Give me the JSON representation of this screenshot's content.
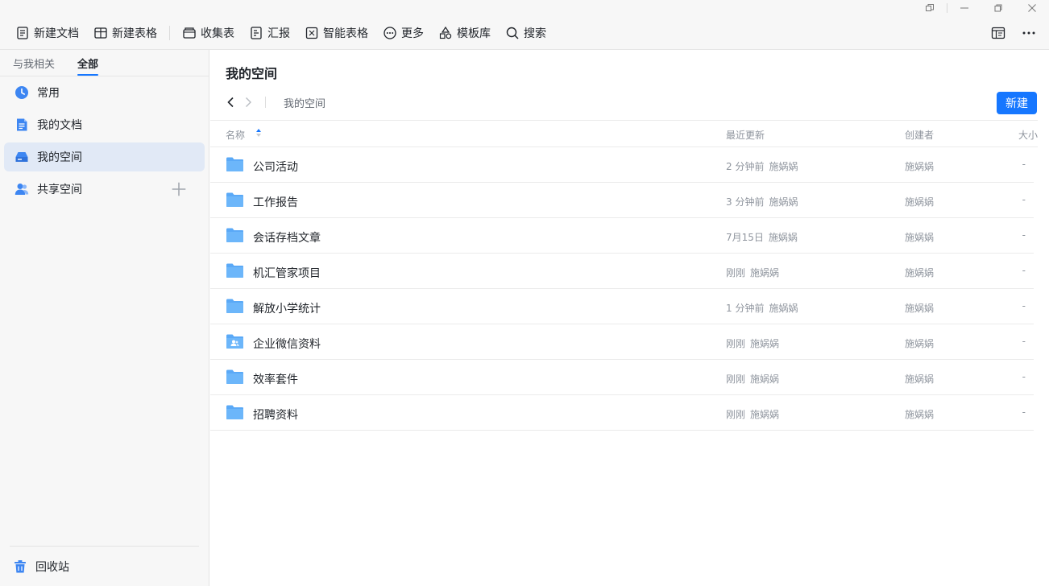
{
  "toolbar": {
    "items": [
      {
        "label": "新建文档",
        "icon": "doc-icon"
      },
      {
        "label": "新建表格",
        "icon": "table-icon"
      },
      {
        "label": "收集表",
        "icon": "form-icon"
      },
      {
        "label": "汇报",
        "icon": "report-icon"
      },
      {
        "label": "智能表格",
        "icon": "smart-table-icon"
      },
      {
        "label": "更多",
        "icon": "more-circle-icon"
      },
      {
        "label": "模板库",
        "icon": "template-icon"
      },
      {
        "label": "搜索",
        "icon": "search-icon"
      }
    ]
  },
  "sidebar": {
    "tabs": [
      "与我相关",
      "全部"
    ],
    "active_tab": 1,
    "items": [
      {
        "label": "常用",
        "icon": "clock-icon"
      },
      {
        "label": "我的文档",
        "icon": "document-icon"
      },
      {
        "label": "我的空间",
        "icon": "drive-icon"
      },
      {
        "label": "共享空间",
        "icon": "shared-users-icon"
      }
    ],
    "active_item": 2,
    "trash_label": "回收站"
  },
  "main": {
    "title": "我的空间",
    "breadcrumb": "我的空间",
    "new_button": "新建",
    "columns": {
      "name": "名称",
      "updated": "最近更新",
      "creator": "创建者",
      "size": "大小"
    },
    "rows": [
      {
        "name": "公司活动",
        "updated": "2 分钟前",
        "updated_by": "施娲娲",
        "creator": "施娲娲",
        "size": "-",
        "shared": false
      },
      {
        "name": "工作报告",
        "updated": "3 分钟前",
        "updated_by": "施娲娲",
        "creator": "施娲娲",
        "size": "-",
        "shared": false
      },
      {
        "name": "会话存档文章",
        "updated": "7月15日",
        "updated_by": "施娲娲",
        "creator": "施娲娲",
        "size": "-",
        "shared": false
      },
      {
        "name": "机汇管家项目",
        "updated": "刚刚",
        "updated_by": "施娲娲",
        "creator": "施娲娲",
        "size": "-",
        "shared": false
      },
      {
        "name": "解放小学统计",
        "updated": "1 分钟前",
        "updated_by": "施娲娲",
        "creator": "施娲娲",
        "size": "-",
        "shared": false
      },
      {
        "name": "企业微信资料",
        "updated": "刚刚",
        "updated_by": "施娲娲",
        "creator": "施娲娲",
        "size": "-",
        "shared": true
      },
      {
        "name": "效率套件",
        "updated": "刚刚",
        "updated_by": "施娲娲",
        "creator": "施娲娲",
        "size": "-",
        "shared": false
      },
      {
        "name": "招聘资料",
        "updated": "刚刚",
        "updated_by": "施娲娲",
        "creator": "施娲娲",
        "size": "-",
        "shared": false
      }
    ]
  },
  "colors": {
    "accent": "#1677ff",
    "folder": "#5aa9f7",
    "active_bg": "#e1e9f6"
  }
}
